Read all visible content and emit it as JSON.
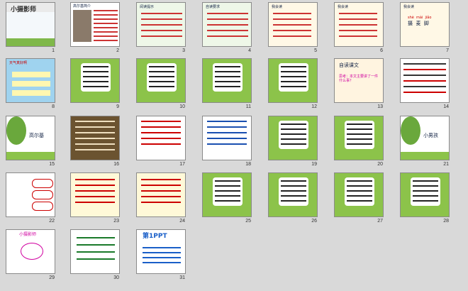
{
  "slides": [
    {
      "n": "1",
      "title": "小摄影师",
      "bg": "#f4f8fb",
      "kind": "title"
    },
    {
      "n": "2",
      "text": "高尔基简介",
      "bg": "#fff",
      "kind": "photo"
    },
    {
      "n": "3",
      "text": "阅读提示",
      "bg": "#eef7e8",
      "kind": "text"
    },
    {
      "n": "4",
      "text": "自读要求",
      "bg": "#eef7e8",
      "kind": "text"
    },
    {
      "n": "5",
      "text": "我会读",
      "bg": "#fff8e6",
      "kind": "words"
    },
    {
      "n": "6",
      "text": "我会读",
      "bg": "#fff8e6",
      "kind": "words"
    },
    {
      "n": "7",
      "text": "我会读",
      "bg": "#fff8e6",
      "kind": "pinyin",
      "pinyin": "shè  mài  jiǎo",
      "chars": "摄  麦  脚"
    },
    {
      "n": "8",
      "text": "天气真好啊",
      "bg": "#ffffff",
      "kind": "sky"
    },
    {
      "n": "9",
      "text": "",
      "bg": "#ffffff",
      "kind": "green"
    },
    {
      "n": "10",
      "text": "",
      "bg": "#ffffff",
      "kind": "green"
    },
    {
      "n": "11",
      "text": "",
      "bg": "#ffffff",
      "kind": "green"
    },
    {
      "n": "12",
      "text": "",
      "bg": "#ffffff",
      "kind": "green"
    },
    {
      "n": "13",
      "text": "自读课文",
      "bg": "#fff4e0",
      "kind": "question",
      "question": "思考：本文主要讲了一件什么事？"
    },
    {
      "n": "14",
      "text": "",
      "bg": "#ffffff",
      "kind": "fill"
    },
    {
      "n": "15",
      "text": "高尔基",
      "bg": "#ffffff",
      "kind": "tree"
    },
    {
      "n": "16",
      "text": "",
      "bg": "#6b5330",
      "kind": "dark"
    },
    {
      "n": "17",
      "text": "",
      "bg": "#ffffff",
      "kind": "note"
    },
    {
      "n": "18",
      "text": "",
      "bg": "#ffffff",
      "kind": "blue"
    },
    {
      "n": "19",
      "text": "",
      "bg": "#ffffff",
      "kind": "green"
    },
    {
      "n": "20",
      "text": "",
      "bg": "#ffffff",
      "kind": "green"
    },
    {
      "n": "21",
      "text": "小男孩",
      "bg": "#ffffff",
      "kind": "tree"
    },
    {
      "n": "22",
      "text": "",
      "bg": "#ffffff",
      "kind": "bubbles"
    },
    {
      "n": "23",
      "text": "",
      "bg": "#fff9d8",
      "kind": "yellow"
    },
    {
      "n": "24",
      "text": "",
      "bg": "#fff9d8",
      "kind": "yellow"
    },
    {
      "n": "25",
      "text": "",
      "bg": "#ffffff",
      "kind": "green"
    },
    {
      "n": "26",
      "text": "",
      "bg": "#ffffff",
      "kind": "green"
    },
    {
      "n": "27",
      "text": "",
      "bg": "#ffffff",
      "kind": "green"
    },
    {
      "n": "28",
      "text": "",
      "bg": "#ffffff",
      "kind": "green"
    },
    {
      "n": "29",
      "text": "小摄影师",
      "bg": "#ffffff",
      "kind": "mind"
    },
    {
      "n": "30",
      "text": "",
      "bg": "#ffffff",
      "kind": "homework"
    },
    {
      "n": "31",
      "text": "第1PPT",
      "bg": "#ffffff",
      "kind": "logo"
    }
  ]
}
